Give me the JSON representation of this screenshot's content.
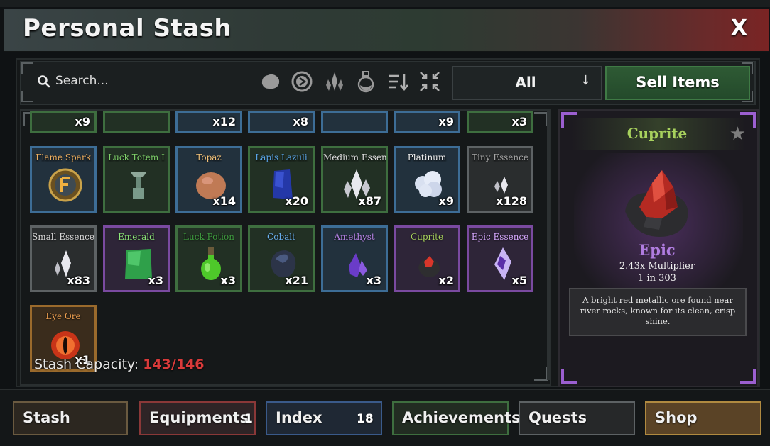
{
  "window": {
    "title": "Personal Stash",
    "close_label": "X"
  },
  "toolbar": {
    "search_placeholder": "Search...",
    "filter_icons": [
      "ore-filter-icon",
      "coin-filter-icon",
      "essence-filter-icon",
      "potion-filter-icon",
      "sort-icon",
      "collapse-icon"
    ],
    "dropdown_value": "All",
    "sell_label": "Sell Items"
  },
  "grid": {
    "partial_row_counts": [
      "x9",
      "",
      "x12",
      "x8",
      "",
      "x9",
      "x3"
    ],
    "items": [
      {
        "name": "Flame Spark",
        "count": "",
        "rarity": "blue",
        "name_color": "#f0b060"
      },
      {
        "name": "Luck Totem I",
        "count": "",
        "rarity": "green",
        "name_color": "#7fd16a"
      },
      {
        "name": "Topaz",
        "count": "x14",
        "rarity": "blue",
        "name_color": "#f2c27a"
      },
      {
        "name": "Lapis Lazuli",
        "count": "x20",
        "rarity": "green",
        "name_color": "#5aa6e8"
      },
      {
        "name": "Medium Essence",
        "count": "x87",
        "rarity": "green",
        "name_color": "#e0e0e0"
      },
      {
        "name": "Platinum",
        "count": "x9",
        "rarity": "blue",
        "name_color": "#f2f2f2"
      },
      {
        "name": "Tiny Essence",
        "count": "x128",
        "rarity": "gray",
        "name_color": "#a8a8a8"
      },
      {
        "name": "Small Essence",
        "count": "x83",
        "rarity": "gray",
        "name_color": "#d8d8d8"
      },
      {
        "name": "Emerald",
        "count": "x3",
        "rarity": "purple",
        "name_color": "#8ee87a"
      },
      {
        "name": "Luck Potion",
        "count": "x3",
        "rarity": "green",
        "name_color": "#3f9a3f"
      },
      {
        "name": "Cobalt",
        "count": "x21",
        "rarity": "green",
        "name_color": "#6ab0ee"
      },
      {
        "name": "Amethyst",
        "count": "x3",
        "rarity": "blue",
        "name_color": "#b784e8"
      },
      {
        "name": "Cuprite",
        "count": "x2",
        "rarity": "purple",
        "name_color": "#a7d15d"
      },
      {
        "name": "Epic Essence",
        "count": "x5",
        "rarity": "purple",
        "name_color": "#d6a8ff"
      },
      {
        "name": "Eye Ore",
        "count": "x1",
        "rarity": "orange",
        "name_color": "#f0a050"
      }
    ],
    "capacity_label": "Stash Capacity:",
    "capacity_value": "143/146"
  },
  "detail": {
    "name": "Cuprite",
    "rarity": "Epic",
    "multiplier": "2.43x Multiplier",
    "odds": "1 in 303",
    "description": "A bright red metallic ore found near river rocks, known for its clean, crisp shine."
  },
  "nav": {
    "stash": "Stash",
    "equipments": "Equipments",
    "equipments_badge": "1",
    "index": "Index",
    "index_badge": "18",
    "achievements": "Achievements",
    "quests": "Quests",
    "shop": "Shop"
  },
  "colors": {
    "capacity_warning": "#d93a3a",
    "epic": "#b07ce0",
    "accent_green": "#3f7a45"
  }
}
